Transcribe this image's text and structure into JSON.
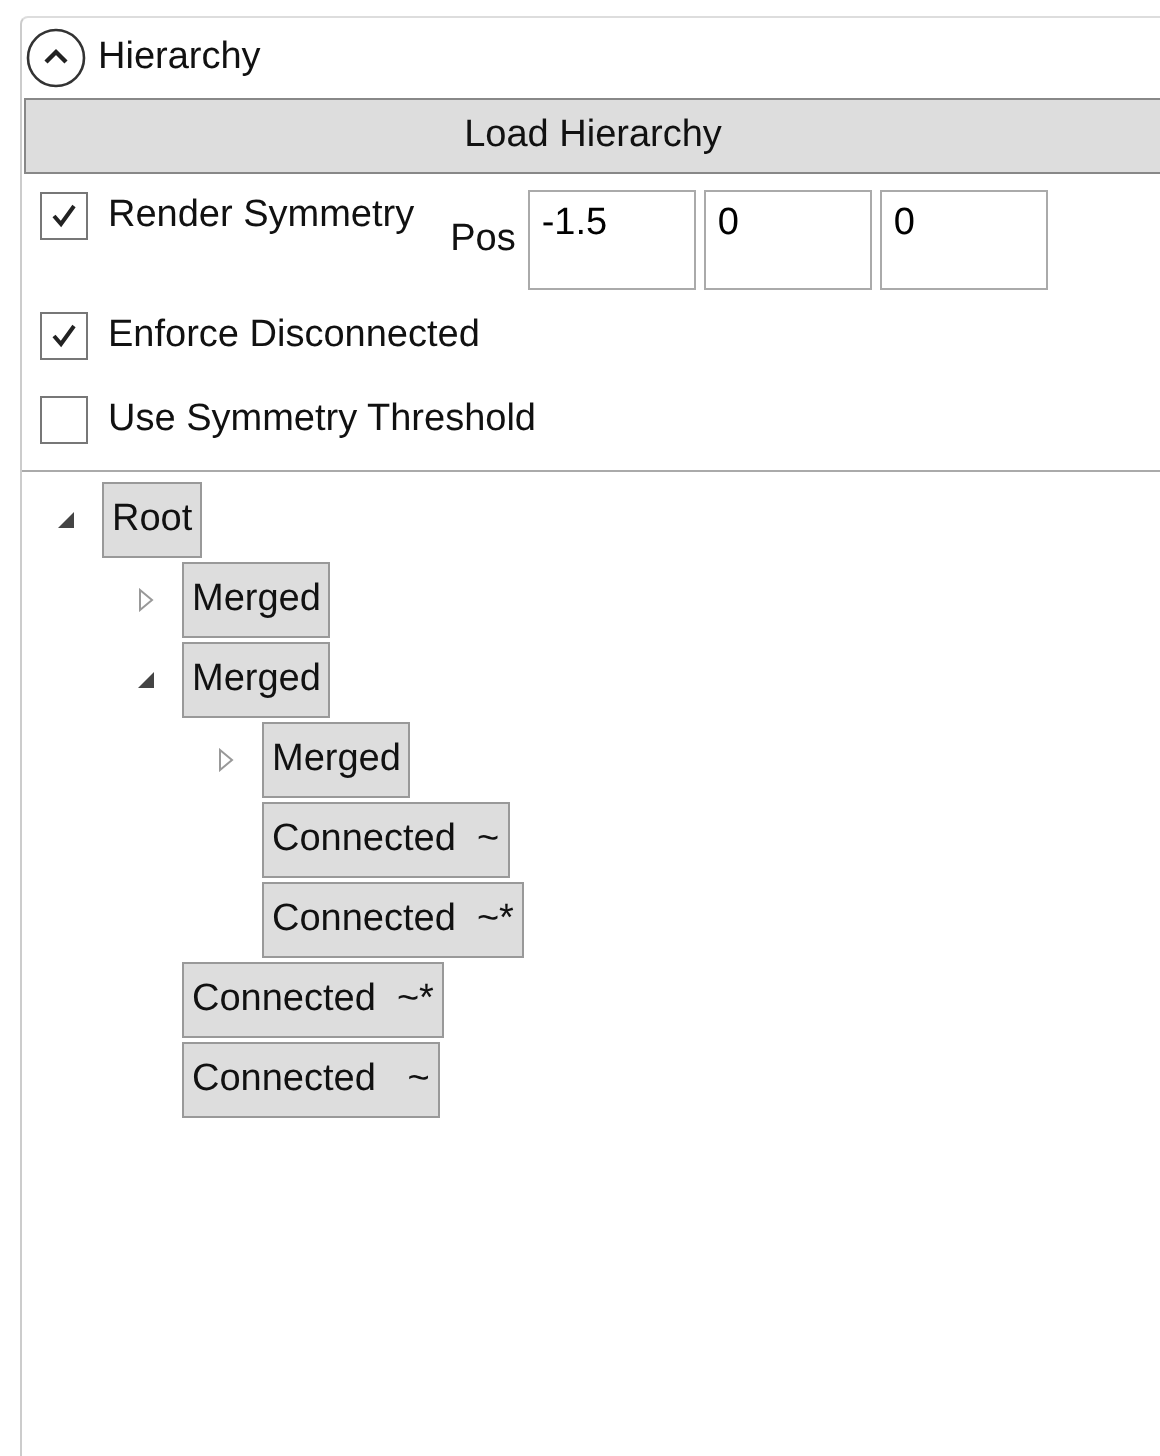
{
  "panel": {
    "title": "Hierarchy",
    "expanded": true
  },
  "load_button": "Load Hierarchy",
  "render_symmetry": {
    "label": "Render Symmetry",
    "checked": true
  },
  "pos": {
    "label": "Pos",
    "values": [
      "-1.5",
      "0",
      "0"
    ]
  },
  "options": [
    {
      "label": "Enforce Disconnected",
      "checked": true
    },
    {
      "label": "Use Symmetry Threshold",
      "checked": false
    }
  ],
  "tree": [
    {
      "label": "Root",
      "kind": "group",
      "expanded": true,
      "children": [
        {
          "label": "Merged",
          "kind": "group",
          "expanded": false
        },
        {
          "label": "Merged",
          "kind": "group",
          "expanded": true,
          "children": [
            {
              "label": "Merged",
              "kind": "group",
              "expanded": false
            },
            {
              "label": "Connected  ~",
              "kind": "leaf"
            },
            {
              "label": "Connected  ~*",
              "kind": "leaf"
            }
          ]
        },
        {
          "label": "Connected  ~*",
          "kind": "leaf"
        },
        {
          "label": "Connected   ~",
          "kind": "leaf"
        }
      ]
    }
  ]
}
